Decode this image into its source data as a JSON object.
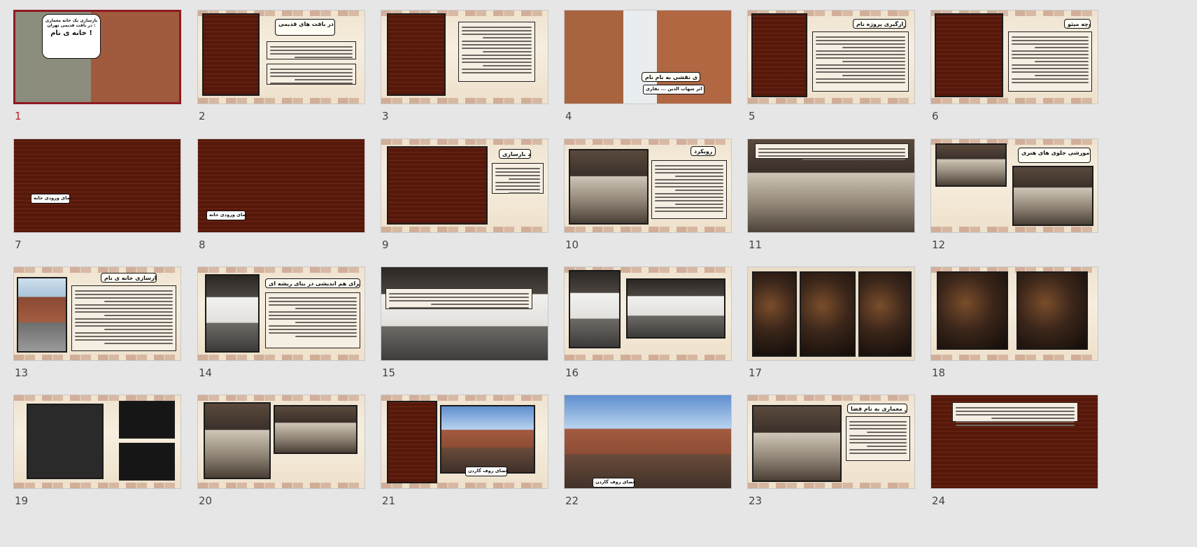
{
  "slides": [
    {
      "number": "1",
      "selected": true,
      "title": "بازسازی یک خانه معماری در بافت قدیمی تهران :",
      "subtitle": "خانه ی نام !"
    },
    {
      "number": "2",
      "title": "تاثیر بازسازی و احیاء بناهای معماری در بافت های قدیمی"
    },
    {
      "number": "3"
    },
    {
      "number": "4",
      "title": "پروژه ی نقشی به نام  نام",
      "caption": "اثر شهاب الدین ... نقاری"
    },
    {
      "number": "5",
      "title": "محل قرارگیری پروژه نام"
    },
    {
      "number": "6",
      "title": "کوچه میثو"
    },
    {
      "number": "7",
      "caption": "نمای ورودی خانه"
    },
    {
      "number": "8",
      "caption": "نمای ورودی خانه"
    },
    {
      "number": "9",
      "title": "روند بازسازی"
    },
    {
      "number": "10",
      "title": "رویکرد"
    },
    {
      "number": "11"
    },
    {
      "number": "12",
      "title": "قرارگیری میزگردهای هنری و سینما در کنار هم و کابینت آموزشی جلوی های هنری"
    },
    {
      "number": "13",
      "title": "پروژه گیری بازسازی خانه ی نام"
    },
    {
      "number": "14",
      "title": "پروژه نام : فضایی برای هم اندیشی در بنای ریشه ای"
    },
    {
      "number": "15"
    },
    {
      "number": "16"
    },
    {
      "number": "17"
    },
    {
      "number": "18"
    },
    {
      "number": "19"
    },
    {
      "number": "20"
    },
    {
      "number": "21",
      "caption": "فضای روف گاردن"
    },
    {
      "number": "22",
      "caption": "فضای روف گاردن"
    },
    {
      "number": "23",
      "title": "ایده ی خلق معماری به نام فضا"
    },
    {
      "number": "24"
    }
  ]
}
